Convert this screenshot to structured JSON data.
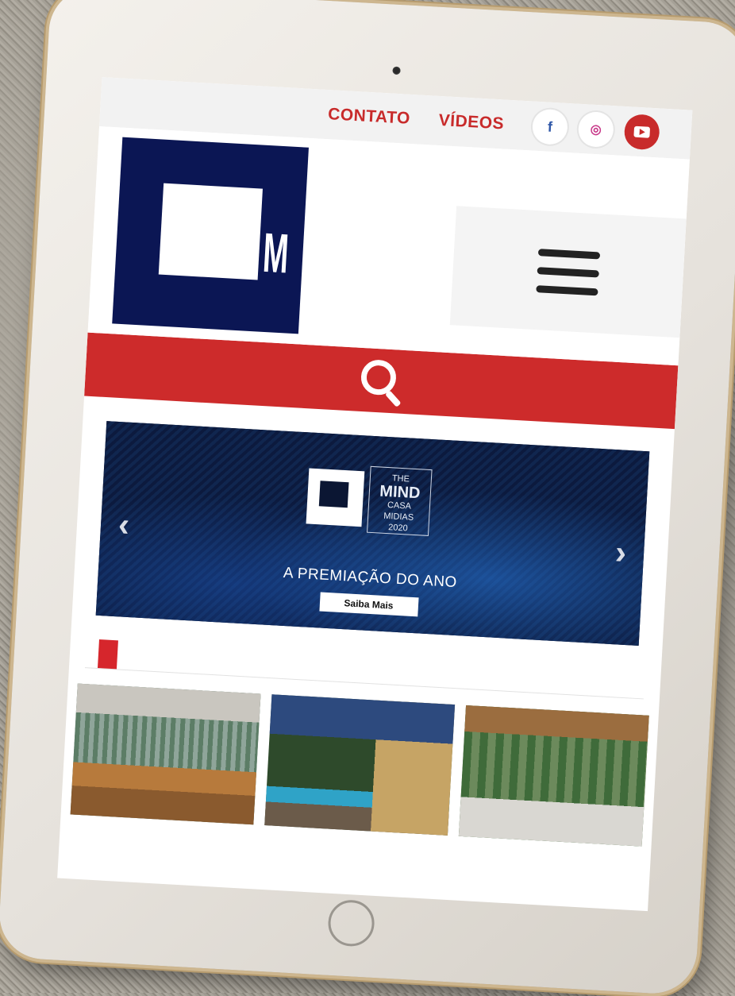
{
  "topbar": {
    "contato": "CONTATO",
    "videos": "VÍDEOS",
    "social": [
      "facebook-icon",
      "instagram-icon",
      "youtube-icon"
    ]
  },
  "header": {
    "logo_letter": "M"
  },
  "banner": {
    "tag_lines": [
      "THE",
      "MIND",
      "CASA",
      "MIDIAS",
      "2020"
    ],
    "title": "A PREMIAÇÃO DO ANO",
    "button": "Saiba Mais"
  },
  "colors": {
    "accent": "#cd2b2b",
    "brand_navy": "#0b1654"
  }
}
